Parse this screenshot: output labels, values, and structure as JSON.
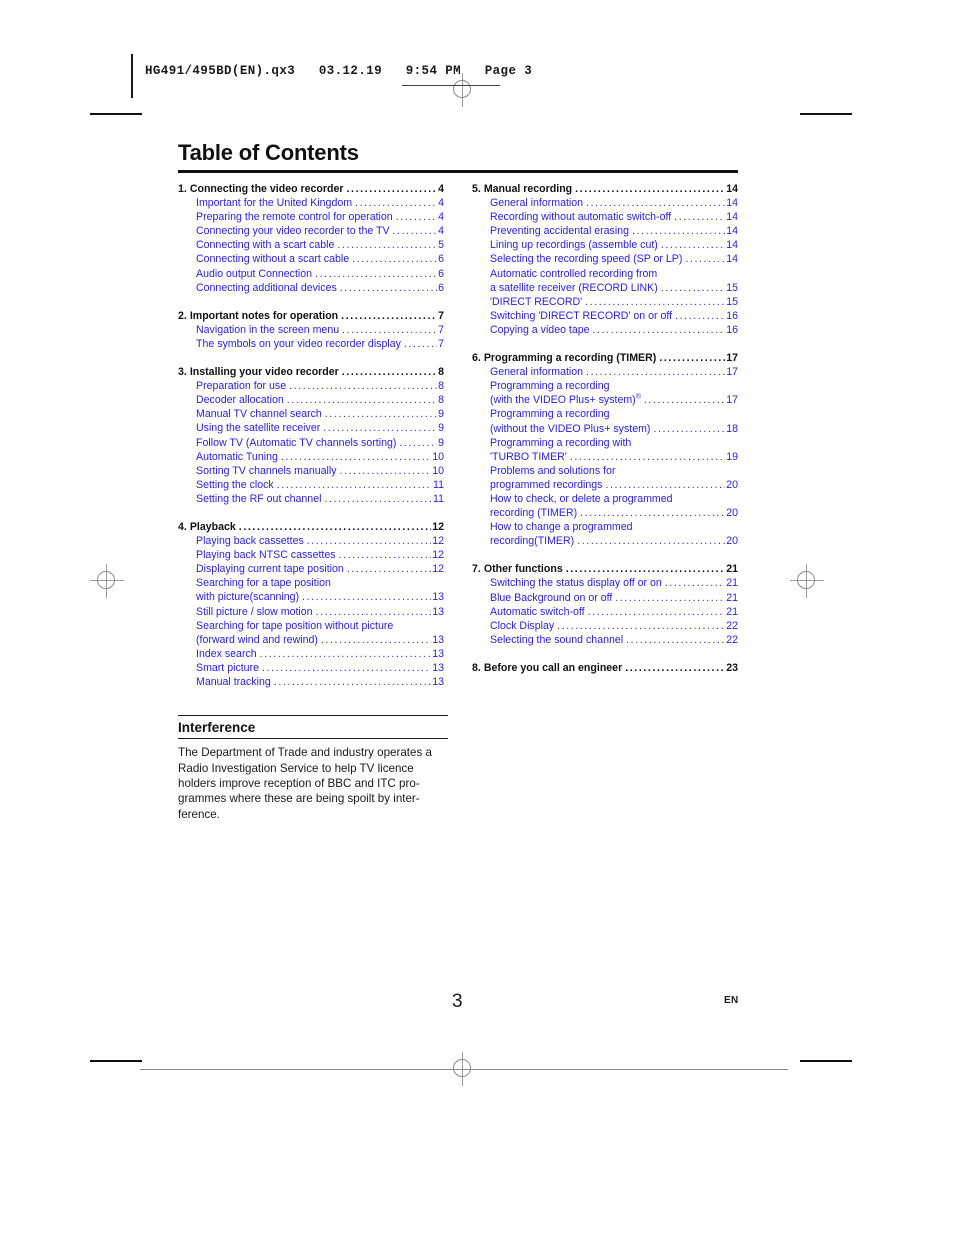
{
  "file_header": {
    "text": "HG491/495BD(EN).qx3   03.12.19   9:54 PM   Page 3"
  },
  "document": {
    "title": "Table of Contents",
    "page_number": "3",
    "language_code": "EN"
  },
  "colors": {
    "link_blue": "#2a21dd",
    "text_black": "#1a1a1a"
  },
  "toc": {
    "left_column": [
      {
        "number": "1.",
        "title": "Connecting the video recorder",
        "page": "4",
        "items": [
          {
            "text": "Important for the United Kingdom",
            "page": "4"
          },
          {
            "text": "Preparing the remote control for operation",
            "page": "4"
          },
          {
            "text": "Connecting your video recorder to the TV",
            "page": "4"
          },
          {
            "text": "Connecting with a scart cable",
            "page": "5"
          },
          {
            "text": "Connecting without a scart cable",
            "page": "6"
          },
          {
            "text": "Audio output Connection",
            "page": "6"
          },
          {
            "text": "Connecting additional devices",
            "page": "6"
          }
        ]
      },
      {
        "number": "2.",
        "title": "Important notes for operation",
        "page": "7",
        "items": [
          {
            "text": "Navigation in the screen menu",
            "page": "7"
          },
          {
            "text": "The symbols on your video recorder display",
            "page": "7"
          }
        ]
      },
      {
        "number": "3.",
        "title": "Installing your video recorder",
        "page": "8",
        "items": [
          {
            "text": "Preparation for use",
            "page": "8"
          },
          {
            "text": "Decoder allocation",
            "page": "8"
          },
          {
            "text": "Manual TV channel search",
            "page": "9"
          },
          {
            "text": "Using the satellite receiver",
            "page": "9"
          },
          {
            "text": "Follow TV (Automatic TV channels sorting)",
            "page": "9"
          },
          {
            "text": "Automatic Tuning",
            "page": "10"
          },
          {
            "text": "Sorting TV channels manually",
            "page": "10"
          },
          {
            "text": "Setting the clock",
            "page": "11"
          },
          {
            "text": "Setting the RF out channel",
            "page": "11"
          }
        ]
      },
      {
        "number": "4.",
        "title": "Playback",
        "page": "12",
        "items": [
          {
            "text": "Playing back cassettes",
            "page": "12"
          },
          {
            "text": "Playing back NTSC cassettes",
            "page": "12"
          },
          {
            "text": "Displaying current tape position",
            "page": "12"
          },
          {
            "text": "Searching for a tape position",
            "page": "",
            "wrap_first": true
          },
          {
            "text": "with picture(scanning)",
            "page": "13"
          },
          {
            "text": "Still picture / slow motion",
            "page": "13"
          },
          {
            "text": "Searching for tape position without picture",
            "page": "",
            "wrap_first": true
          },
          {
            "text": "(forward wind and rewind)",
            "page": "13"
          },
          {
            "text": "Index search",
            "page": "13"
          },
          {
            "text": "Smart picture",
            "page": "13"
          },
          {
            "text": "Manual tracking",
            "page": "13"
          }
        ]
      }
    ],
    "right_column": [
      {
        "number": "5.",
        "title": "Manual recording",
        "page": "14",
        "items": [
          {
            "text": "General information",
            "page": "14"
          },
          {
            "text": "Recording without automatic switch-off",
            "page": "14"
          },
          {
            "text": "Preventing accidental erasing",
            "page": "14"
          },
          {
            "text": "Lining up recordings (assemble cut)",
            "page": "14"
          },
          {
            "text": "Selecting the recording speed (SP or LP)",
            "page": "14"
          },
          {
            "text": "Automatic controlled recording from",
            "page": "",
            "wrap_first": true
          },
          {
            "text": " a satellite receiver (RECORD LINK)",
            "page": "15"
          },
          {
            "text": "'DIRECT RECORD'",
            "page": "15"
          },
          {
            "text": "Switching 'DIRECT RECORD' on or off",
            "page": "16"
          },
          {
            "text": "Copying a video tape",
            "page": "16"
          }
        ]
      },
      {
        "number": "6.",
        "title": "Programming a recording (TIMER)",
        "page": "17",
        "items": [
          {
            "text": "General information",
            "page": "17"
          },
          {
            "text": "Programming a recording",
            "page": "",
            "wrap_first": true
          },
          {
            "text": "(with the VIDEO Plus+® system)",
            "page": "17",
            "has_reg": true
          },
          {
            "text": "Programming a recording",
            "page": "",
            "wrap_first": true
          },
          {
            "text": "(without the VIDEO Plus+ system)",
            "page": "18"
          },
          {
            "text": "Programming a recording with",
            "page": "",
            "wrap_first": true
          },
          {
            "text": "'TURBO TIMER'",
            "page": "19"
          },
          {
            "text": "Problems and solutions for",
            "page": "",
            "wrap_first": true
          },
          {
            "text": "programmed recordings",
            "page": "20"
          },
          {
            "text": "How to check, or delete a programmed",
            "page": "",
            "wrap_first": true
          },
          {
            "text": "recording (TIMER)",
            "page": "20"
          },
          {
            "text": "How to change a programmed",
            "page": "",
            "wrap_first": true
          },
          {
            "text": "recording(TIMER)",
            "page": "20"
          }
        ]
      },
      {
        "number": "7.",
        "title": "Other functions",
        "page": "21",
        "items": [
          {
            "text": "Switching the status display off or on",
            "page": "21"
          },
          {
            "text": "Blue Background on or off",
            "page": "21"
          },
          {
            "text": "Automatic switch-off",
            "page": "21"
          },
          {
            "text": "Clock Display",
            "page": "22"
          },
          {
            "text": "Selecting the sound channel",
            "page": "22"
          }
        ]
      },
      {
        "number": "8.",
        "title": "Before you call an engineer",
        "page": "23",
        "items": []
      }
    ]
  },
  "interference": {
    "heading": "Interference",
    "body": "The Department of Trade and industry operates a Radio Investigation Service to help TV licence holders improve reception of BBC and ITC pro-grammes where these are being spoilt by inter-ference."
  }
}
